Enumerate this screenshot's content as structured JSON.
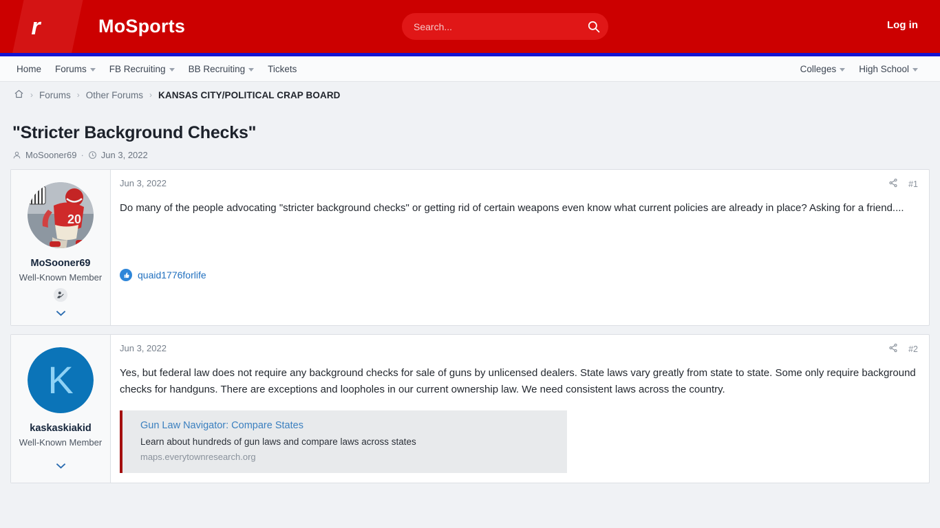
{
  "header": {
    "logo_mark": "r",
    "site_title": "MoSports",
    "search_placeholder": "Search...",
    "search_value": "",
    "search_icon": "search-icon",
    "login_label": "Log in"
  },
  "nav": {
    "left_items": [
      {
        "label": "Home",
        "has_caret": false
      },
      {
        "label": "Forums",
        "has_caret": true
      },
      {
        "label": "FB Recruiting",
        "has_caret": true
      },
      {
        "label": "BB Recruiting",
        "has_caret": true
      },
      {
        "label": "Tickets",
        "has_caret": false
      }
    ],
    "right_items": [
      {
        "label": "Colleges",
        "has_caret": true
      },
      {
        "label": "High School",
        "has_caret": true
      }
    ]
  },
  "breadcrumb": {
    "home_icon": "home-icon",
    "sep": "›",
    "items": [
      {
        "label": "Forums",
        "current": false
      },
      {
        "label": "Other Forums",
        "current": false
      },
      {
        "label": "KANSAS CITY/POLITICAL CRAP BOARD",
        "current": true
      }
    ]
  },
  "thread": {
    "title": "\"Stricter Background Checks\"",
    "author_icon": "user-icon",
    "author": "MoSooner69",
    "meta_dot": "·",
    "time_icon": "clock-icon",
    "date": "Jun 3, 2022"
  },
  "posts": [
    {
      "avatar_type": "image",
      "avatar_letter": "",
      "username": "MoSooner69",
      "rank": "Well-Known Member",
      "badge_icon": "member-badge-icon",
      "expand_icon": "chevron-down-icon",
      "date": "Jun 3, 2022",
      "share_icon": "share-icon",
      "post_number": "#1",
      "body": "Do many of the people advocating \"stricter background checks\" or getting rid of certain weapons even know what current policies are already in place? Asking for a friend....",
      "reaction": {
        "icon": "thumbs-up-icon",
        "user": "quaid1776forlife"
      },
      "unfurl": null
    },
    {
      "avatar_type": "letter",
      "avatar_letter": "K",
      "username": "kaskaskiakid",
      "rank": "Well-Known Member",
      "badge_icon": "",
      "expand_icon": "chevron-down-icon",
      "date": "Jun 3, 2022",
      "share_icon": "share-icon",
      "post_number": "#2",
      "body": "Yes, but federal law does not require any background checks for sale of guns by unlicensed dealers. State laws vary greatly from state to state. Some only require background checks for handguns. There are exceptions and loopholes in our current ownership law. We need consistent laws across the country.",
      "reaction": null,
      "unfurl": {
        "title": "Gun Law Navigator: Compare States",
        "description": "Learn about hundreds of gun laws and compare laws across states",
        "host": "maps.everytownresearch.org"
      }
    }
  ],
  "colors": {
    "brand_red": "#cc0000",
    "accent_blue": "#1414d2",
    "link_blue": "#1f6fbf",
    "page_bg": "#f0f2f5",
    "unfurl_accent": "#a40f0f"
  }
}
